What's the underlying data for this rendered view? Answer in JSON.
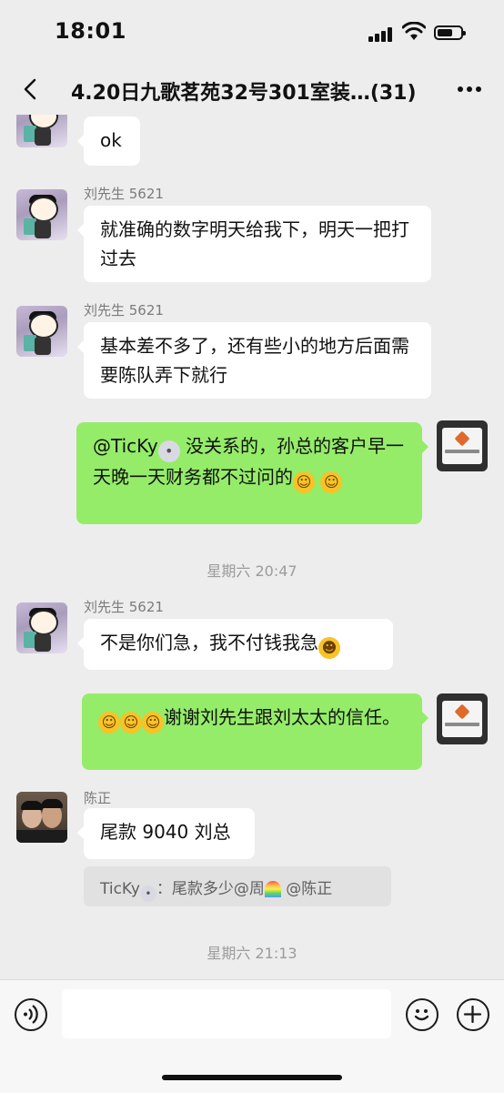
{
  "status_bar": {
    "time": "18:01"
  },
  "header": {
    "title": "4.20日九歌茗苑32号301室装…(31)"
  },
  "messages": [
    {
      "text": "ok"
    },
    {
      "sender": "刘先生 5621",
      "text": "就准确的数字明天给我下，明天一把打过去"
    },
    {
      "sender": "刘先生 5621",
      "text": "基本差不多了，还有些小的地方后面需要陈队弄下就行"
    },
    {
      "text_a": "@TicKy",
      "text_b": " 没关系的，孙总的客户早一天晚一天财务都不过问的"
    },
    {
      "sender": "刘先生 5621",
      "text": "不是你们急，我不付钱我急"
    },
    {
      "text": "谢谢刘先生跟刘太太的信任。"
    },
    {
      "sender": "陈正",
      "text": "尾款 9040 刘总"
    }
  ],
  "timestamps": [
    "星期六 20:47",
    "星期六 21:13"
  ],
  "quote": {
    "author": "TicKy",
    "sep": "：",
    "text_a": "尾款多少@周",
    "text_b": " @陈正"
  },
  "icons": {
    "back": "chevron-left-icon",
    "more": "ellipsis-icon",
    "voice": "voice-icon",
    "emoji": "emoji-icon",
    "add": "plus-icon"
  },
  "colors": {
    "background": "#ededed",
    "bubble_self": "#95ec69",
    "bubble_other": "#ffffff"
  }
}
